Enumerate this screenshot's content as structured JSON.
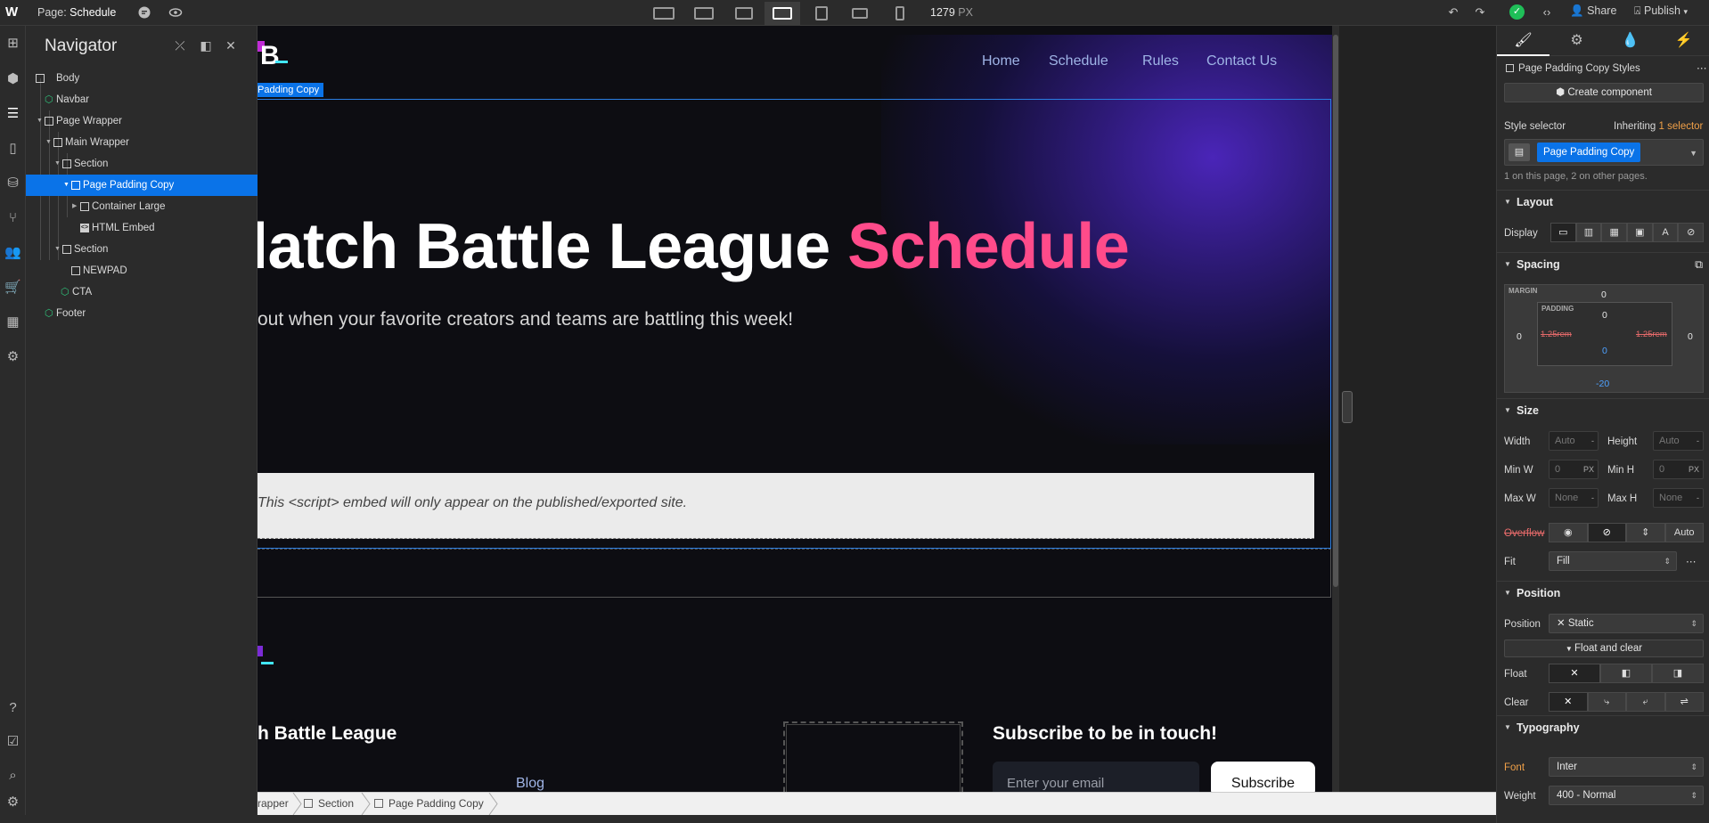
{
  "topbar": {
    "logo": "W",
    "page_prefix": "Page:",
    "page_name": "Schedule",
    "width_value": "1279",
    "width_unit": "PX",
    "share": "Share",
    "publish": "Publish"
  },
  "navigator": {
    "title": "Navigator",
    "items": [
      {
        "label": "Body"
      },
      {
        "label": "Navbar"
      },
      {
        "label": "Page Wrapper"
      },
      {
        "label": "Main Wrapper"
      },
      {
        "label": "Section"
      },
      {
        "label": "Page Padding Copy"
      },
      {
        "label": "Container Large"
      },
      {
        "label": "HTML Embed"
      },
      {
        "label": "Section"
      },
      {
        "label": "NEWPAD"
      },
      {
        "label": "CTA"
      },
      {
        "label": "Footer"
      }
    ]
  },
  "canvas": {
    "nav_links": [
      "Home",
      "Schedule",
      "Rules",
      "Contact Us"
    ],
    "selected_tag": "Padding Copy",
    "hero_title_white": "latch Battle League ",
    "hero_title_pink": "Schedule",
    "hero_subtitle": "out when your favorite creators and teams are battling this week!",
    "embed_note": "This <script> embed will only appear on the published/exported site.",
    "footer_brand": "h Battle League",
    "footer_link": "Blog",
    "subscribe_title": "Subscribe to be in touch!",
    "email_placeholder": "Enter your email",
    "subscribe_button": "Subscribe",
    "colors": {
      "pink": "#ff4b8a",
      "link": "#9fb4e6",
      "bg": "#0d0d12"
    }
  },
  "breadcrumbs": [
    "rapper",
    "Section",
    "Page Padding Copy"
  ],
  "panel": {
    "styles_label": "Page Padding Copy Styles",
    "create_component": "Create component",
    "style_selector": "Style selector",
    "inheriting_prefix": "Inheriting",
    "inheriting_count": "1",
    "inheriting_suffix": "selector",
    "selector_chip": "Page Padding Copy",
    "usage_note": "1 on this page, 2 on other pages.",
    "layout": {
      "title": "Layout",
      "display_label": "Display"
    },
    "spacing": {
      "title": "Spacing",
      "margin_label": "MARGIN",
      "padding_label": "PADDING",
      "margin_top": "0",
      "margin_left": "0",
      "margin_right": "0",
      "margin_bottom": "-20",
      "padding_top": "0",
      "padding_left": "1.25rem",
      "padding_right": "1.25rem",
      "padding_bottom": "0"
    },
    "size": {
      "title": "Size",
      "width_label": "Width",
      "width_value": "Auto",
      "width_unit": "-",
      "height_label": "Height",
      "height_value": "Auto",
      "height_unit": "-",
      "minw_label": "Min W",
      "minw_value": "0",
      "minw_unit": "PX",
      "minh_label": "Min H",
      "minh_value": "0",
      "minh_unit": "PX",
      "maxw_label": "Max W",
      "maxw_value": "None",
      "maxw_unit": "-",
      "maxh_label": "Max H",
      "maxh_value": "None",
      "maxh_unit": "-",
      "overflow_label": "Overflow",
      "overflow_auto": "Auto",
      "fit_label": "Fit",
      "fit_value": "Fill"
    },
    "position": {
      "title": "Position",
      "position_label": "Position",
      "position_value": "Static",
      "float_clear_button": "Float and clear",
      "float_label": "Float",
      "clear_label": "Clear"
    },
    "typography": {
      "title": "Typography",
      "font_label": "Font",
      "font_value": "Inter",
      "weight_label": "Weight",
      "weight_value": "400 - Normal"
    }
  }
}
